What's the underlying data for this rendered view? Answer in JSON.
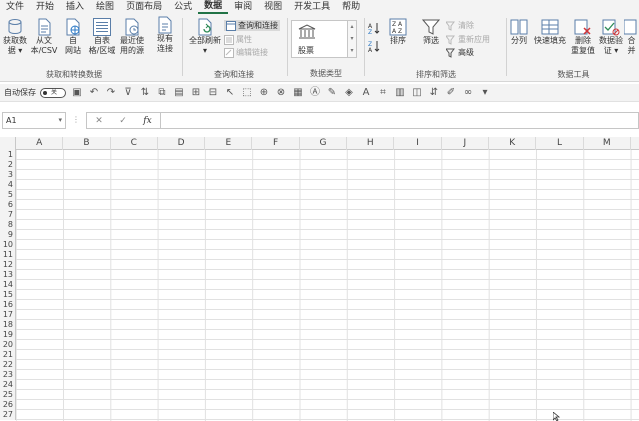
{
  "menu": [
    "文件",
    "开始",
    "插入",
    "绘图",
    "页面布局",
    "公式",
    "数据",
    "审阅",
    "视图",
    "开发工具",
    "帮助"
  ],
  "active_menu": "数据",
  "ribbon": {
    "get_data": {
      "group_label": "获取和转换数据",
      "buttons": [
        "获取数\n据 ▾",
        "从文\n本/CSV",
        "自\n网站",
        "自表\n格/区域",
        "最近使\n用的源",
        "现有\n连接"
      ]
    },
    "queries": {
      "group_label": "查询和连接",
      "refresh_label": "全部刷新\n▾",
      "small": [
        "查询和连接",
        "属性",
        "编辑链接"
      ]
    },
    "data_types": {
      "group_label": "数据类型",
      "stock_label": "股票"
    },
    "sort_filter": {
      "group_label": "排序和筛选",
      "sort_label": "排序",
      "filter_label": "筛选",
      "small": [
        "清除",
        "重新应用",
        "高级"
      ]
    },
    "data_tools": {
      "group_label": "数据工具",
      "buttons": [
        "分列",
        "快速填充",
        "删除\n重复值",
        "数据验\n证 ▾",
        "合并"
      ]
    }
  },
  "qat": {
    "autosave_label": "自动保存",
    "toggle_label": "关"
  },
  "namebox": {
    "value": "A1"
  },
  "formula_bar": {
    "fx_label": "fx",
    "cancel": "✕",
    "enter": "✓"
  },
  "columns": [
    "A",
    "B",
    "C",
    "D",
    "E",
    "F",
    "G",
    "H",
    "I",
    "J",
    "K",
    "L",
    "M"
  ],
  "rows": [
    "1",
    "2",
    "3",
    "4",
    "5",
    "6",
    "7",
    "8",
    "9",
    "10",
    "11",
    "12",
    "13",
    "14",
    "15",
    "16",
    "17",
    "18",
    "19",
    "20",
    "21",
    "22",
    "23",
    "24",
    "25",
    "26",
    "27"
  ],
  "colors": {
    "accent": "#217346",
    "chrome": "#f3f3f3",
    "gridline": "#e1e1e1"
  }
}
